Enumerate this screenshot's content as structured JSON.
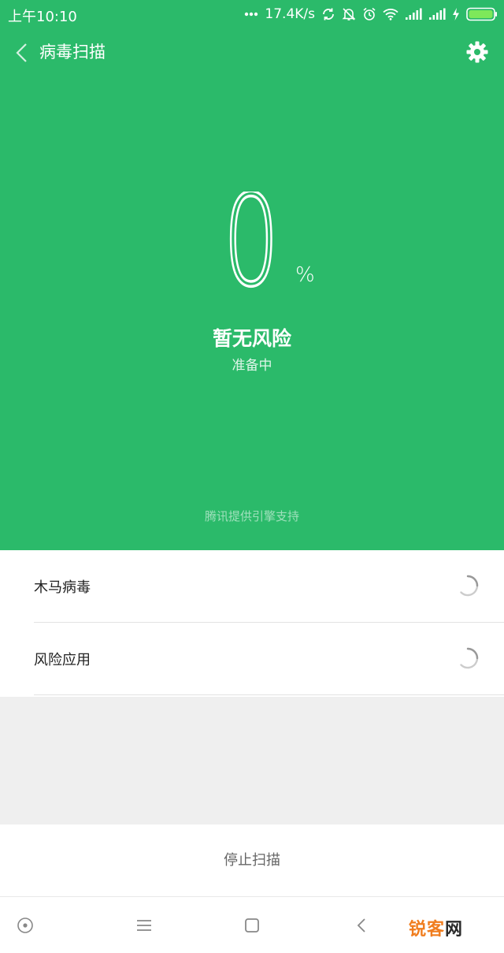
{
  "status_bar": {
    "time": "上午10:10",
    "network_speed": "17.4K/s",
    "icons": [
      "more-dots-icon",
      "sync-icon",
      "mute-bell-icon",
      "alarm-icon",
      "wifi-icon",
      "signal-icon",
      "signal-icon",
      "charging-icon",
      "battery-icon"
    ]
  },
  "header": {
    "title": "病毒扫描",
    "back_icon": "chevron-left-icon",
    "settings_icon": "gear-icon"
  },
  "scan": {
    "progress_percent": 0,
    "progress_text": "0",
    "percent_sign": "%",
    "risk_status": "暂无风险",
    "phase": "准备中",
    "engine_note": "腾讯提供引擎支持"
  },
  "items": [
    {
      "label": "木马病毒",
      "state_icon": "loading-spinner-icon"
    },
    {
      "label": "风险应用",
      "state_icon": "loading-spinner-icon"
    }
  ],
  "actions": {
    "stop_label": "停止扫描"
  },
  "nav_bar": {
    "icons": [
      "circle-dot-icon",
      "menu-icon",
      "square-icon",
      "back-icon"
    ]
  },
  "watermark": {
    "text_main": "锐客",
    "text_last": "网"
  },
  "colors": {
    "primary_green": "#2bba6a",
    "background_gray": "#efefef",
    "watermark_orange": "#f07d1e"
  }
}
